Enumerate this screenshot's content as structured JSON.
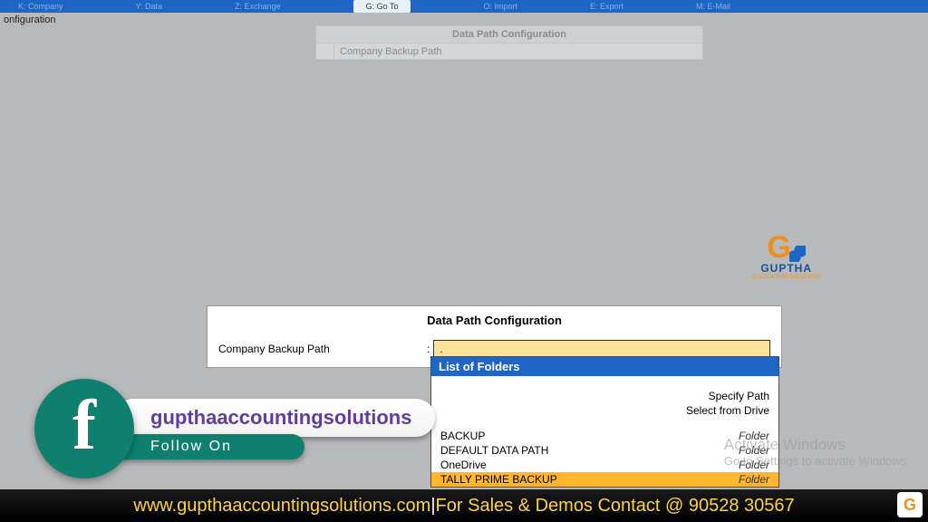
{
  "topbar": {
    "items": [
      "K: Company",
      "Y: Data",
      "Z: Exchange",
      "",
      "O: Import",
      "E: Export",
      "M: E-Mail"
    ],
    "active": "G: Go To"
  },
  "crumb": "onfiguration",
  "ghost": {
    "title": "Data Path Configuration",
    "row": "Company Backup Path"
  },
  "logo": {
    "brand": "GUPTHA",
    "sub": "ACCOUNTING SOLUTIONS"
  },
  "panel": {
    "title": "Data Path Configuration",
    "label": "Company Backup Path",
    "colon": ":",
    "value": "."
  },
  "dropdown": {
    "header": "List of Folders",
    "options": [
      "Specify Path",
      "Select from Drive"
    ],
    "items": [
      {
        "name": "BACKUP",
        "type": "Folder",
        "sel": false
      },
      {
        "name": "DEFAULT DATA PATH",
        "type": "Folder",
        "sel": false
      },
      {
        "name": "OneDrive",
        "type": "Folder",
        "sel": false
      },
      {
        "name": "TALLY PRIME BACKUP",
        "type": "Folder",
        "sel": true
      }
    ]
  },
  "watermark": {
    "l1": "Activate Windows",
    "l2": "Go to Settings to activate Windows."
  },
  "social": {
    "handle": "gupthaaccountingsolutions",
    "follow": "Follow On"
  },
  "footer": {
    "site": "www.gupthaaccountingsolutions.com",
    "sep": " | ",
    "rest": "For Sales & Demos Contact @ 90528 30567"
  }
}
